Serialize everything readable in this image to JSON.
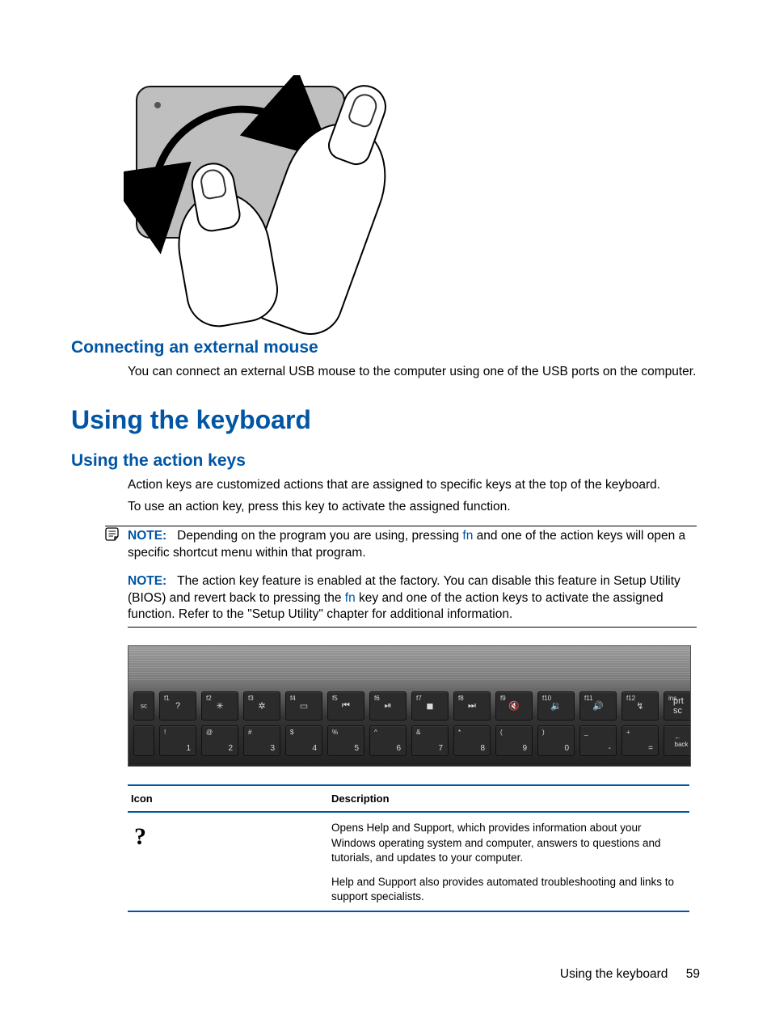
{
  "sections": {
    "s1_title": "Connecting an external mouse",
    "s1_body": "You can connect an external USB mouse to the computer using one of the USB ports on the computer.",
    "s2_title": "Using the keyboard",
    "s3_title": "Using the action keys",
    "s3_p1": "Action keys are customized actions that are assigned to specific keys at the top of the keyboard.",
    "s3_p2": "To use an action key, press this key to activate the assigned function."
  },
  "note": {
    "label": "NOTE:",
    "n1_a": "Depending on the program you are using, pressing ",
    "n1_fn": "fn",
    "n1_b": " and one of the action keys will open a specific shortcut menu within that program.",
    "n2_a": "The action key feature is enabled at the factory. You can disable this feature in Setup Utility (BIOS) and revert back to pressing the ",
    "n2_fn": "fn",
    "n2_b": " key and one of the action keys to activate the assigned function. Refer to the \"Setup Utility\" chapter for additional information."
  },
  "keyboard": {
    "row1_icons": [
      "?",
      "✳",
      "✲",
      "▭",
      "⏮",
      "⏯",
      "◼",
      "⏭",
      "🔇",
      "🔉",
      "🔊",
      "↯",
      "prt sc"
    ],
    "row1_fn": [
      "f1",
      "f2",
      "f3",
      "f4",
      "f5",
      "f6",
      "f7",
      "f8",
      "f9",
      "f10",
      "f11",
      "f12",
      "ins"
    ],
    "row2_top": [
      "!",
      "@",
      "#",
      "$",
      "%",
      "^",
      "&",
      "*",
      "(",
      ")",
      "_",
      "+"
    ],
    "row2_bot": [
      "1",
      "2",
      "3",
      "4",
      "5",
      "6",
      "7",
      "8",
      "9",
      "0",
      "-",
      "="
    ],
    "back_label": "← back"
  },
  "table": {
    "h_icon": "Icon",
    "h_desc": "Description",
    "row1_icon": "?",
    "row1_p1": "Opens Help and Support, which provides information about your Windows operating system and computer, answers to questions and tutorials, and updates to your computer.",
    "row1_p2": "Help and Support also provides automated troubleshooting and links to support specialists."
  },
  "footer": {
    "text": "Using the keyboard",
    "page": "59"
  }
}
